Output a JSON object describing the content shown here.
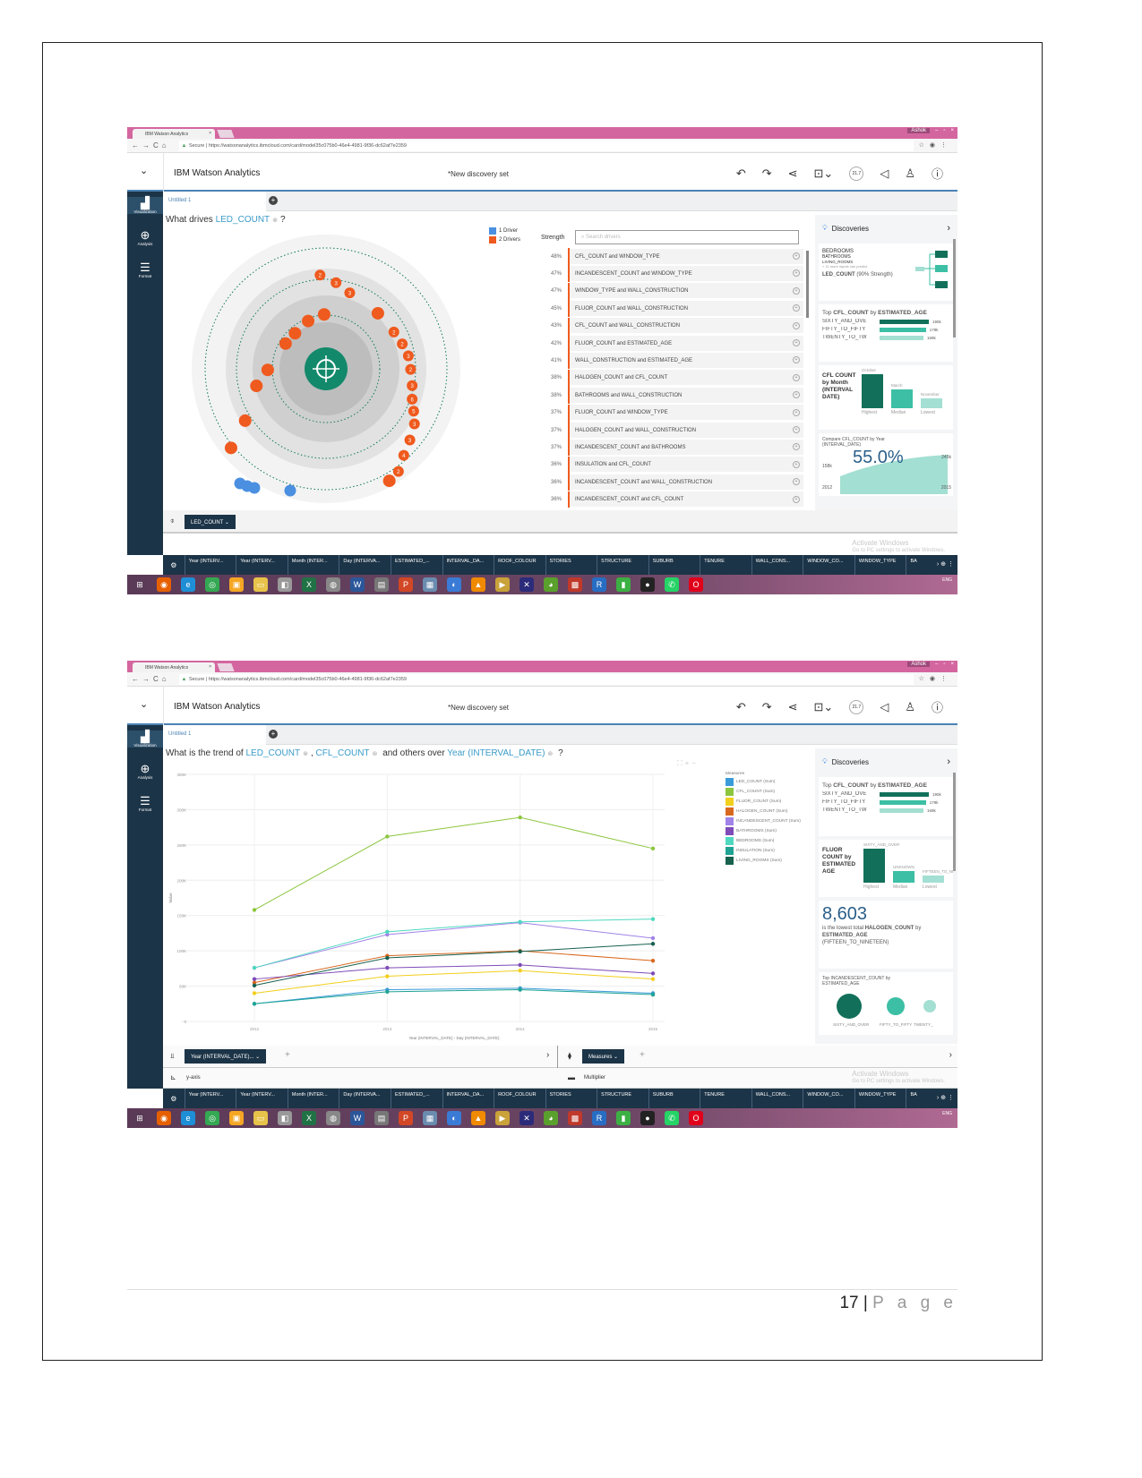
{
  "page": {
    "number": "17",
    "separator": "|",
    "page_word": "P a g e"
  },
  "browser": {
    "tab_title": "IBM Watson Analytics",
    "secure_label": "Secure",
    "url": "https://watsonanalytics.ibmcloud.com/card/model35c075b0-46e4-4981-9f36-dc62af7e2359",
    "user_label": "Ashok"
  },
  "app": {
    "title": "IBM Watson Analytics",
    "discovery_set": "*New discovery set",
    "badge": "21.7",
    "sidebar": [
      {
        "label": "Visualization",
        "icon": "bar-chart-icon"
      },
      {
        "label": "Analysis",
        "icon": "magnifier-icon"
      },
      {
        "label": "Format",
        "icon": "sliders-icon"
      }
    ],
    "tab_label": "Untitled 1",
    "columns": [
      "Year (INTERV...",
      "Year (INTERV...",
      "Month (INTER...",
      "Day (INTERVA...",
      "ESTIMATED_...",
      "INTERVAL_DA...",
      "ROOF_COLOUR",
      "STORIES",
      "STRUCTURE",
      "SUBURB",
      "TENURE",
      "WALL_CONS...",
      "WINDOW_CO...",
      "WINDOW_TYPE",
      "BA"
    ],
    "activate_title": "Activate Windows",
    "activate_sub": "Go to PC settings to activate Windows.",
    "tray_lang": "ENG"
  },
  "screen1": {
    "question_prefix": "What drives",
    "target": "LED_COUNT",
    "question_suffix": "?",
    "legend": [
      {
        "label": "1 Driver",
        "color": "#4a8fe0"
      },
      {
        "label": "2 Drivers",
        "color": "#ef5a1e"
      }
    ],
    "orbit_labels": [
      "2",
      "3",
      "3",
      "2",
      "2",
      "3",
      "2",
      "3",
      "6",
      "5",
      "3",
      "3",
      "4",
      "2"
    ],
    "strength_label": "Strength",
    "search_placeholder": "Search drivers",
    "drivers": [
      {
        "pct": "48%",
        "name": "CFL_COUNT and WINDOW_TYPE"
      },
      {
        "pct": "47%",
        "name": "INCANDESCENT_COUNT and WINDOW_TYPE"
      },
      {
        "pct": "47%",
        "name": "WINDOW_TYPE and WALL_CONSTRUCTION"
      },
      {
        "pct": "45%",
        "name": "FLUOR_COUNT and WALL_CONSTRUCTION"
      },
      {
        "pct": "43%",
        "name": "CFL_COUNT and WALL_CONSTRUCTION"
      },
      {
        "pct": "42%",
        "name": "FLUOR_COUNT and ESTIMATED_AGE"
      },
      {
        "pct": "41%",
        "name": "WALL_CONSTRUCTION and ESTIMATED_AGE"
      },
      {
        "pct": "38%",
        "name": "HALOGEN_COUNT and CFL_COUNT"
      },
      {
        "pct": "38%",
        "name": "BATHROOMS and WALL_CONSTRUCTION"
      },
      {
        "pct": "37%",
        "name": "FLUOR_COUNT and WINDOW_TYPE"
      },
      {
        "pct": "37%",
        "name": "HALOGEN_COUNT and WALL_CONSTRUCTION"
      },
      {
        "pct": "37%",
        "name": "INCANDESCENT_COUNT and BATHROOMS"
      },
      {
        "pct": "36%",
        "name": "INSULATION and CFL_COUNT"
      },
      {
        "pct": "36%",
        "name": "INCANDESCENT_COUNT and WALL_CONSTRUCTION"
      },
      {
        "pct": "36%",
        "name": "INCANDESCENT_COUNT and CFL_COUNT"
      }
    ],
    "discoveries": {
      "title": "Discoveries",
      "inputs": [
        "BEDROOMS",
        "BATHROOMS",
        "LIVING_ROOMS"
      ],
      "more_inputs": "+ 11 more inputs can predict",
      "predicted": "LED_COUNT",
      "predicted_strength": "(90% Strength)",
      "top_prefix": "Top",
      "top_measure": "CFL_COUNT",
      "top_by": "by",
      "top_dim": "ESTIMATED_AGE",
      "top_bars": [
        {
          "label": "SIXTY_AND_OVE",
          "value": "190k",
          "pct": 100,
          "color": "#12705a"
        },
        {
          "label": "FIFTY_TO_FIFTY",
          "value": "179k",
          "pct": 94,
          "color": "#3cbfa4"
        },
        {
          "label": "TWENTY_TO_TW",
          "value": "169k",
          "pct": 89,
          "color": "#a3dfd2"
        }
      ],
      "month_title": "CFL COUNT by Month (INTERVAL DATE)",
      "month_bars": [
        {
          "top": "October",
          "bottom": "Highest",
          "pct": 100,
          "color": "#12705a"
        },
        {
          "top": "March",
          "bottom": "Median",
          "pct": 55,
          "color": "#3cbfa4"
        },
        {
          "top": "November",
          "bottom": "Lowest",
          "pct": 30,
          "color": "#a3dfd2"
        }
      ],
      "compare_title": "Compare CFL_COUNT by Year (INTERVAL_DATE)",
      "compare_value": "55.0%",
      "compare_start": "158k",
      "compare_end": "245k",
      "compare_from": "2012",
      "compare_to": "2015"
    },
    "target_pill": "LED_COUNT"
  },
  "screen2": {
    "question_prefix": "What is the trend of",
    "tok1": "LED_COUNT",
    "sep": ",",
    "tok2": "CFL_COUNT",
    "mid": "and others over",
    "tok3": "Year (INTERVAL_DATE)",
    "suffix": "?",
    "legend_title": "Measures",
    "x_pill": "Year (INTERVAL_DATE)...",
    "color_pill": "Measures",
    "y_axis_row": "y-axis",
    "multiplier_row": "Multiplier",
    "discoveries": {
      "title": "Discoveries",
      "top_prefix": "Top",
      "top_measure": "CFL_COUNT",
      "top_by": "by",
      "top_dim": "ESTIMATED_AGE",
      "top_bars": [
        {
          "label": "SIXTY_AND_OVE",
          "value": "190k",
          "pct": 100,
          "color": "#12705a"
        },
        {
          "label": "FIFTY_TO_FIFTY",
          "value": "179k",
          "pct": 94,
          "color": "#3cbfa4"
        },
        {
          "label": "TWENTY_TO_TW",
          "value": "169k",
          "pct": 89,
          "color": "#a3dfd2"
        }
      ],
      "fluor_title": "FLUOR COUNT by ESTIMATED AGE",
      "fluor_bars": [
        {
          "top": "SIXTY_AND_OVER",
          "bottom": "Highest",
          "pct": 100,
          "color": "#12705a"
        },
        {
          "top": "UNKNOWN",
          "bottom": "Median",
          "pct": 35,
          "color": "#3cbfa4"
        },
        {
          "top": "FIFTEEN_TO_NI",
          "bottom": "Lowest",
          "pct": 22,
          "color": "#a3dfd2"
        }
      ],
      "kpi_value": "8,603",
      "kpi_text1": "is the lowest total",
      "kpi_measure": "HALOGEN_COUNT",
      "kpi_by": "by",
      "kpi_dim": "ESTIMATED_AGE",
      "kpi_cat": "(FIFTEEN_TO_NINETEEN)",
      "bubble_title": "Top INCANDESCENT_COUNT by ESTIMATED_AGE",
      "bubbles": [
        {
          "label": "SIXTY_AND_OVER",
          "size": 1.0,
          "color": "#12705a"
        },
        {
          "label": "FIFTY_TO_FIFTY",
          "size": 0.5,
          "color": "#3cbfa4"
        },
        {
          "label": "TWENTY_",
          "size": 0.25,
          "color": "#a3dfd2"
        }
      ]
    }
  },
  "chart_data": {
    "type": "line",
    "title": "",
    "xlabel": "Year (INTERVAL_DATE) - Day (INTERVAL_DATE)",
    "ylabel": "Value",
    "x": [
      "2012",
      "2013",
      "2014",
      "2015"
    ],
    "ylim": [
      0,
      350000
    ],
    "yticks": [
      "0",
      "50K",
      "100K",
      "150K",
      "200K",
      "250K",
      "300K",
      "350K"
    ],
    "grid": true,
    "legend_position": "right",
    "series": [
      {
        "name": "LED_COUNT (Sum)",
        "color": "#3a9bd9",
        "values": [
          25000,
          45000,
          47000,
          40000
        ]
      },
      {
        "name": "CFL_COUNT (Sum)",
        "color": "#8cc63f",
        "values": [
          158000,
          262000,
          289000,
          245000
        ]
      },
      {
        "name": "FLUOR_COUNT (Sum)",
        "color": "#f2cf1d",
        "values": [
          40000,
          64000,
          72000,
          60000
        ]
      },
      {
        "name": "HALOGEN_COUNT (Sum)",
        "color": "#d9681f",
        "values": [
          55000,
          93000,
          100000,
          86000
        ]
      },
      {
        "name": "INCANDESCENT_COUNT (Sum)",
        "color": "#a083e8",
        "values": [
          76000,
          123000,
          140000,
          118000
        ]
      },
      {
        "name": "BATHROOMS (Sum)",
        "color": "#7e4bb8",
        "values": [
          60000,
          76000,
          80000,
          68000
        ]
      },
      {
        "name": "BEDROOMS (Sum)",
        "color": "#4fd8c0",
        "values": [
          76000,
          127000,
          141000,
          145000
        ]
      },
      {
        "name": "INSULATION (Sum)",
        "color": "#1fa394",
        "values": [
          25000,
          42000,
          45000,
          38000
        ]
      },
      {
        "name": "LIVING_ROOMS (Sum)",
        "color": "#17614f",
        "values": [
          51000,
          90000,
          99000,
          110000
        ]
      }
    ]
  }
}
